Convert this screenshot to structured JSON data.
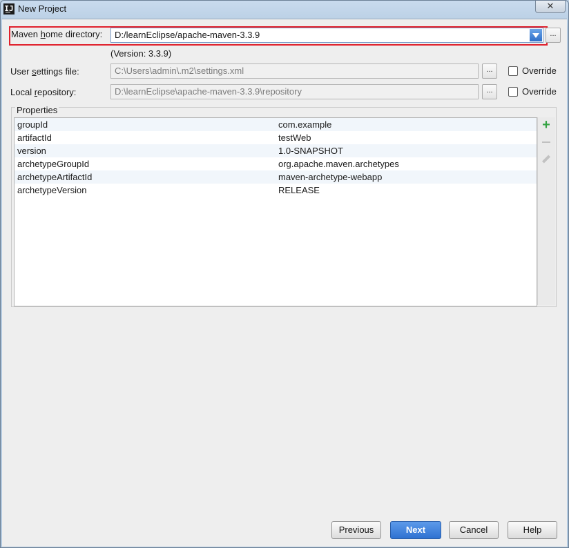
{
  "window": {
    "title": "New Project",
    "close_label": "✕"
  },
  "maven_home": {
    "label_prefix": "Maven ",
    "label_mnemonic": "h",
    "label_suffix": "ome directory:",
    "value": "D:/learnEclipse/apache-maven-3.3.9",
    "version_note": "(Version: 3.3.9)"
  },
  "user_settings": {
    "label_prefix": "User ",
    "label_mnemonic": "s",
    "label_suffix": "ettings file:",
    "value": "C:\\Users\\admin\\.m2\\settings.xml",
    "override_label": "Override"
  },
  "local_repository": {
    "label_prefix": "Local ",
    "label_mnemonic": "r",
    "label_suffix": "epository:",
    "value": "D:\\learnEclipse\\apache-maven-3.3.9\\repository",
    "override_label": "Override"
  },
  "ellipsis_label": "...",
  "properties": {
    "title": "Properties",
    "rows": [
      {
        "key": "groupId",
        "value": "com.example"
      },
      {
        "key": "artifactId",
        "value": "testWeb"
      },
      {
        "key": "version",
        "value": "1.0-SNAPSHOT"
      },
      {
        "key": "archetypeGroupId",
        "value": "org.apache.maven.archetypes"
      },
      {
        "key": "archetypeArtifactId",
        "value": "maven-archetype-webapp"
      },
      {
        "key": "archetypeVersion",
        "value": "RELEASE"
      }
    ],
    "tools": {
      "add": "+"
    }
  },
  "buttons": {
    "previous": "Previous",
    "next": "Next",
    "cancel": "Cancel",
    "help": "Help"
  },
  "colors": {
    "highlight": "#e0202c",
    "primary": "#2f72d1",
    "add_icon": "#34a343"
  }
}
